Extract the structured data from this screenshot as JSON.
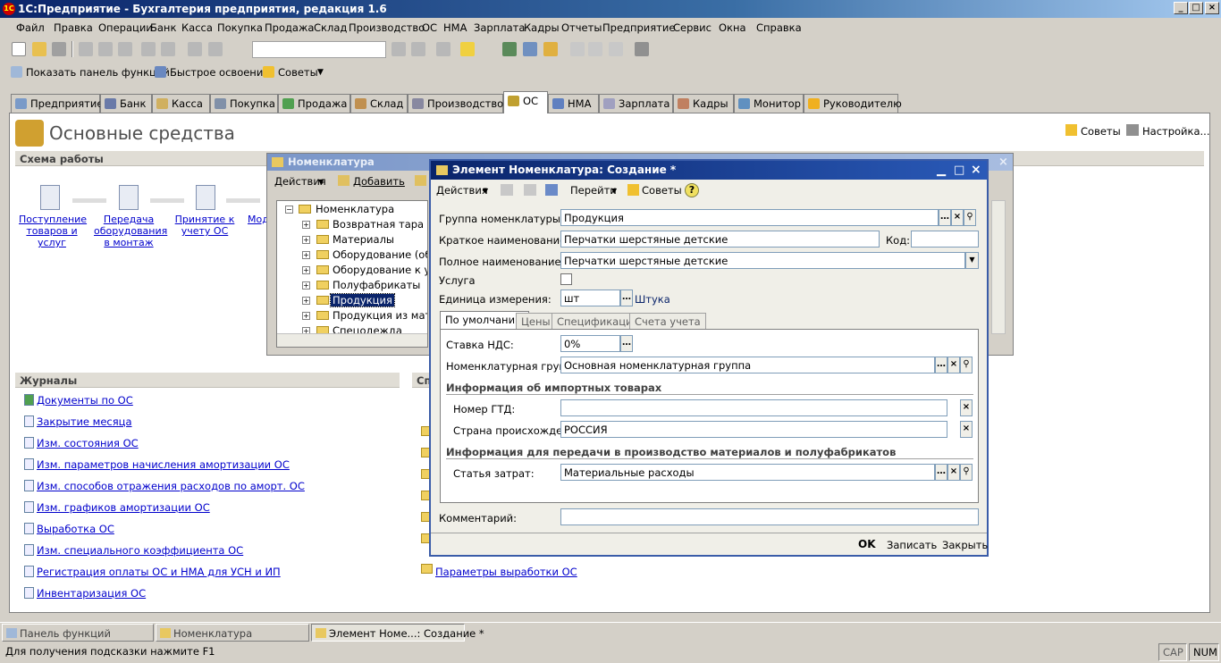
{
  "app": {
    "title": "1С:Предприятие - Бухгалтерия предприятия, редакция 1.6"
  },
  "menu": [
    "Файл",
    "Правка",
    "Операции",
    "Банк",
    "Касса",
    "Покупка",
    "Продажа",
    "Склад",
    "Производство",
    "ОС",
    "НМА",
    "Зарплата",
    "Кадры",
    "Отчеты",
    "Предприятие",
    "Сервис",
    "Окна",
    "Справка"
  ],
  "toolbar2": {
    "show_panel": "Показать панель функций",
    "quick": "Быстрое освоение",
    "tips": "Советы"
  },
  "main_tabs": [
    "Предприятие",
    "Банк",
    "Касса",
    "Покупка",
    "Продажа",
    "Склад",
    "Производство",
    "ОС",
    "НМА",
    "Зарплата",
    "Кадры",
    "Монитор",
    "Руководителю"
  ],
  "panel": {
    "title": "Основные средства",
    "tips": "Советы",
    "settings": "Настройка...",
    "scheme_header": "Схема работы",
    "scheme_links": [
      "Поступление товаров и услуг",
      "Передача оборудования в монтаж",
      "Принятие к учету ОС",
      "Мод"
    ],
    "journals_header": "Журналы",
    "journals": [
      "Документы по ОС",
      "Закрытие месяца",
      "Изм. состояния ОС",
      "Изм. параметров начисления амортизации ОС",
      "Изм. способов отражения расходов по аморт. ОС",
      "Изм. графиков амортизации ОС",
      "Выработка ОС",
      "Изм. специального коэффициента ОС",
      "Регистрация оплаты ОС и НМА для УСН и ИП",
      "Инвентаризация ОС"
    ],
    "ref_header": "Спр",
    "ref_last": "Параметры выработки ОС"
  },
  "nom_window": {
    "title": "Номенклатура",
    "actions": "Действия",
    "add": "Добавить",
    "tree": [
      "Номенклатура",
      "Возвратная тара",
      "Материалы",
      "Оборудование (объек",
      "Оборудование к уста",
      "Полуфабрикаты",
      "Продукция",
      "Продукция из матери",
      "Спецодежда"
    ]
  },
  "dialog": {
    "title": "Элемент Номенклатура: Создание *",
    "actions": "Действия",
    "goto": "Перейти",
    "tips": "Советы",
    "help": "?",
    "group_label": "Группа номенклатуры:",
    "group_value": "Продукция",
    "short_label": "Краткое наименование:",
    "short_value": "Перчатки шерстяные детские",
    "code_label": "Код:",
    "code_value": "",
    "full_label": "Полное наименование:",
    "full_value": "Перчатки шерстяные детские",
    "service_label": "Услуга",
    "unit_label": "Единица измерения:",
    "unit_value": "шт",
    "unit_name": "Штука",
    "tabs": [
      "По умолчанию",
      "Цены",
      "Спецификации",
      "Счета учета"
    ],
    "vat_label": "Ставка НДС:",
    "vat_value": "0%",
    "nomgroup_label": "Номенклатурная группа:",
    "nomgroup_value": "Основная номенклатурная группа",
    "import_header": "Информация об импортных товарах",
    "gtd_label": "Номер ГТД:",
    "gtd_value": "",
    "country_label": "Страна происхождения:",
    "country_value": "РОССИЯ",
    "prod_header": "Информация для передачи в производство материалов и полуфабрикатов",
    "cost_label": "Статья затрат:",
    "cost_value": "Материальные расходы",
    "comment_label": "Комментарий:",
    "comment_value": "",
    "ok": "OK",
    "save": "Записать",
    "close": "Закрыть"
  },
  "taskbar": [
    "Панель функций",
    "Номенклатура",
    "Элемент Номе...: Создание *"
  ],
  "status": {
    "hint": "Для получения подсказки нажмите F1",
    "cap": "CAP",
    "num": "NUM"
  }
}
